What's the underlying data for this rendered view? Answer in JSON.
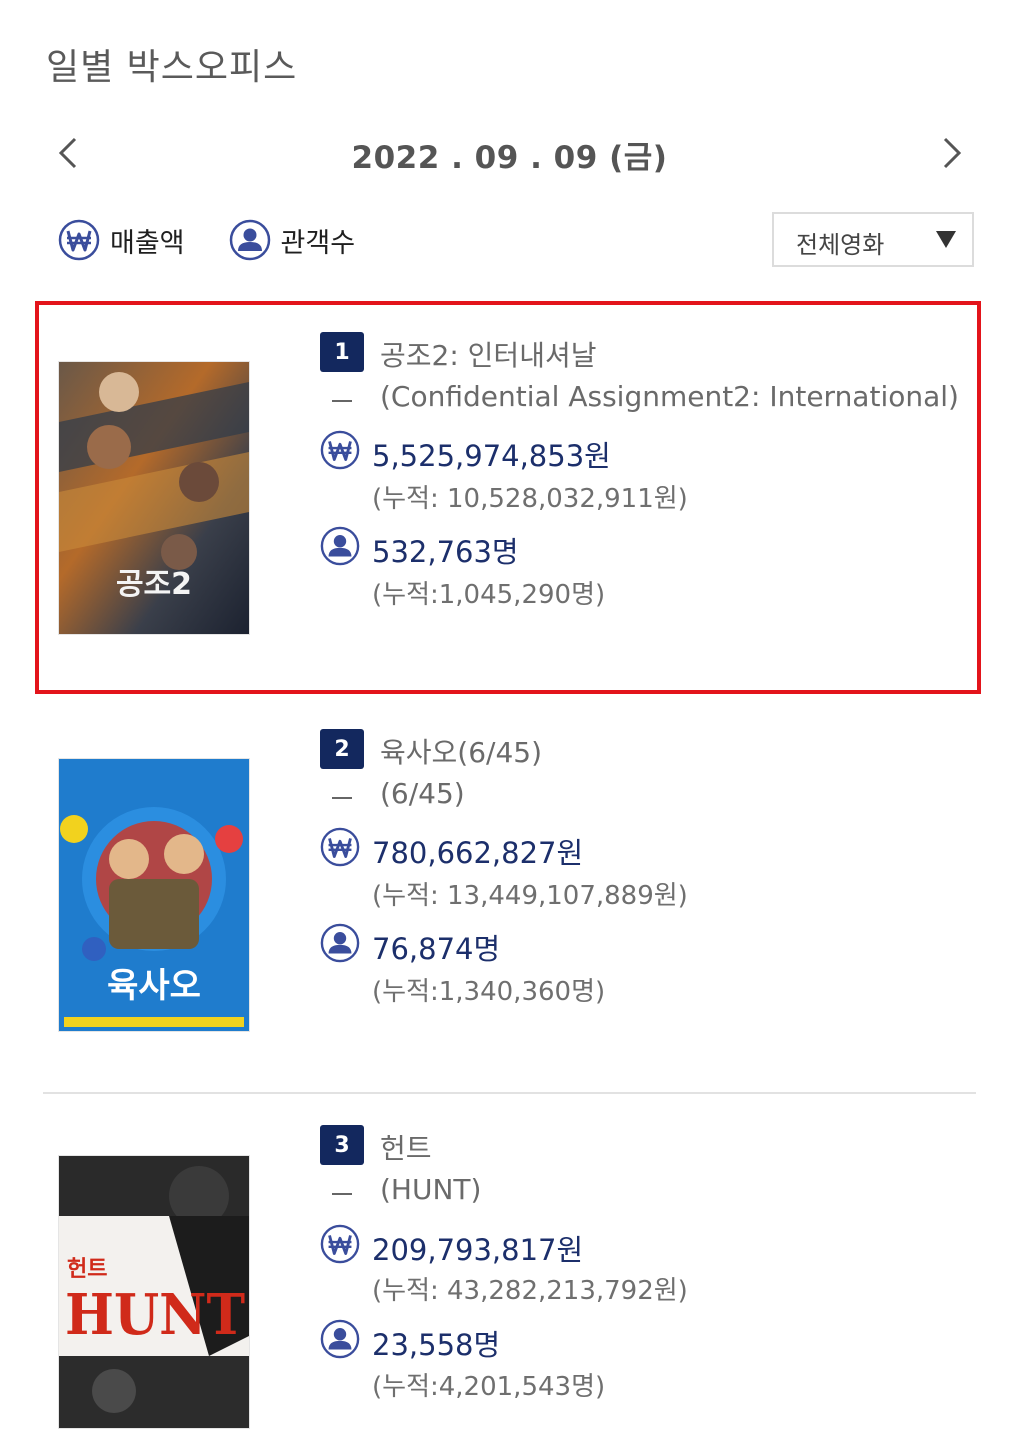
{
  "page_title": "일별 박스오피스",
  "date_nav": {
    "date": "2022 . 09 . 09  (금)"
  },
  "toggles": {
    "sales_label": "매출액",
    "audience_label": "관객수"
  },
  "filter": {
    "selected": "전체영화"
  },
  "colors": {
    "accent_navy": "#13285e",
    "icon_blue": "#3a4d9c",
    "highlight_red": "#e3141b"
  },
  "movies": [
    {
      "rank": "1",
      "title": "공조2: 인터내셔날",
      "subtitle": "(Confidential Assignment2: International)",
      "sales": "5,525,974,853원",
      "sales_total": "(누적: 10,528,032,911원)",
      "audience": "532,763명",
      "audience_total": "(누적:1,045,290명)",
      "poster_text": "공조2",
      "highlighted": true
    },
    {
      "rank": "2",
      "title": "육사오(6/45)",
      "subtitle": "(6/45)",
      "sales": "780,662,827원",
      "sales_total": "(누적: 13,449,107,889원)",
      "audience": "76,874명",
      "audience_total": "(누적:1,340,360명)",
      "poster_text": "육사오",
      "highlighted": false
    },
    {
      "rank": "3",
      "title": "헌트",
      "subtitle": "(HUNT)",
      "sales": "209,793,817원",
      "sales_total": "(누적: 43,282,213,792원)",
      "audience": "23,558명",
      "audience_total": "(누적:4,201,543명)",
      "poster_text": "헌트",
      "poster_text2": "HUNT",
      "highlighted": false
    }
  ]
}
